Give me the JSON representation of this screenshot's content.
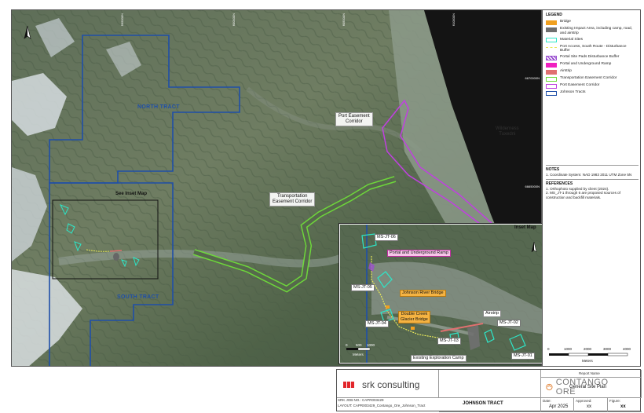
{
  "map": {
    "coordinates_top": [
      "595000N",
      "600000N",
      "605000N",
      "610000N",
      "615000N"
    ],
    "coordinates_right": [
      "6670000N",
      "6665000N"
    ],
    "tract_labels": {
      "north": "NORTH TRACT",
      "south": "SOUTH TRACT"
    },
    "labels": {
      "port_corridor": "Port Easement\nCorridor",
      "transport_corridor": "Transportation\nEasement Corridor",
      "see_inset": "See Inset Map",
      "wilderness": "Wilderness\nTuxedni"
    },
    "north_arrow": "N"
  },
  "inset": {
    "title": "Inset Map",
    "labels": {
      "portal": "Portal and Underground Ramp",
      "johnson_bridge": "Johnson River Bridge",
      "double_creek": "Double Creek\nGlacier Bridge",
      "airstrip": "Airstrip",
      "camp": "Existing Exploration Camp"
    },
    "material_sites": [
      "MS-JT-06",
      "MS-JT-05",
      "MS-JT-04",
      "MS-JT-03",
      "MS-JT-02",
      "MS-JT-01"
    ],
    "scale": {
      "ticks": [
        "0",
        "500",
        "1000"
      ],
      "unit": "Meters"
    }
  },
  "legend": {
    "title": "LEGEND",
    "items": [
      {
        "label": "Bridge",
        "color": "#f0a020",
        "style": "fill"
      },
      {
        "label": "Existing Impact Area, including camp, road, and airstrip",
        "color": "#6e6e6e",
        "style": "fill"
      },
      {
        "label": "Material Sites",
        "color": "#2ee6c8",
        "style": "outline"
      },
      {
        "label": "Port Access, South Route - Disturbance Buffer",
        "color": "#e8e85a",
        "style": "dash"
      },
      {
        "label": "Portal Site Pads Disturbance Buffer",
        "color": "#9a4fd0",
        "style": "hatch"
      },
      {
        "label": "Portal and Underground Ramp",
        "color": "#f020c0",
        "style": "fill"
      },
      {
        "label": "Airstrip",
        "color": "#e07070",
        "style": "fill"
      },
      {
        "label": "Transportation Easement Corridor",
        "color": "#6fdc3a",
        "style": "outline"
      },
      {
        "label": "Port Easement Corridor",
        "color": "#c040e0",
        "style": "outline"
      },
      {
        "label": "Johnson Tracts",
        "color": "#1f4fa8",
        "style": "outline"
      }
    ],
    "notes_title": "NOTES",
    "notes": [
      "1. Coordinate System: NAD 1983 2011 UTM Zone 5N"
    ],
    "references_title": "REFERENCES",
    "references": [
      "1. Orthophoto supplied by client (2024).",
      "2. MS_JT-1 through 6 are proposed sources of construction and backfill materials."
    ],
    "scale": {
      "ticks": [
        "0",
        "1000",
        "2000",
        "3000",
        "4000"
      ],
      "unit": "Meters"
    }
  },
  "title_block": {
    "company": "srk consulting",
    "client": "CONTANGO ORE",
    "project": "JOHNSON TRACT",
    "report_name_label": "Report Name",
    "report_name": "General Site Plan",
    "date_label": "Date:",
    "date": "Apr 2025",
    "approved_label": "Approved:",
    "approved": "xx",
    "figure_label": "Figure:",
    "figure": "xx",
    "job_no": "SRK JOB NO.: CAPR003429",
    "layout": "LAYOUT: CAPR003429_Contango_Ore_Johnson_Tract"
  }
}
